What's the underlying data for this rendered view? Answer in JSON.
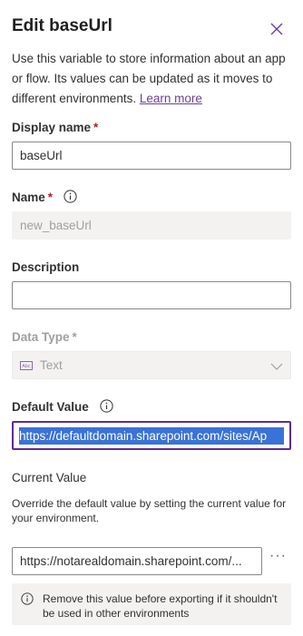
{
  "panel": {
    "title": "Edit baseUrl",
    "description": "Use this variable to store information about an app or flow. Its values can be updated as it moves to different environments.",
    "learn_more": "Learn more"
  },
  "display_name": {
    "label": "Display name",
    "required_mark": "*",
    "value": "baseUrl"
  },
  "name": {
    "label": "Name",
    "required_mark": "*",
    "value": "new_baseUrl"
  },
  "description_field": {
    "label": "Description",
    "value": ""
  },
  "data_type": {
    "label": "Data Type",
    "required_mark": "*",
    "value": "Text"
  },
  "default_value": {
    "label": "Default Value",
    "value": "https://defaultdomain.sharepoint.com/sites/Ap"
  },
  "current_value": {
    "heading": "Current Value",
    "help": "Override the default value by setting the current value for your environment.",
    "value": "https://notarealdomain.sharepoint.com/...",
    "more_label": "···",
    "notice": "Remove this value before exporting if it shouldn't be used in other environments"
  },
  "icons": {
    "close": "close-icon",
    "info": "info-icon",
    "text_type": "text-type-icon",
    "chevron": "chevron-down-icon"
  },
  "colors": {
    "accent": "#5c2d91",
    "link": "#6b3f9a",
    "required": "#a4262c",
    "selection": "#3a72d8"
  }
}
